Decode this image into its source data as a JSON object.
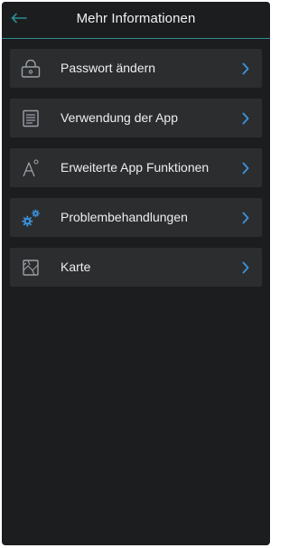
{
  "header": {
    "title": "Mehr Informationen",
    "back_icon": "arrow-left-icon"
  },
  "menu": {
    "items": [
      {
        "label": "Passwort ändern",
        "icon": "lock-icon"
      },
      {
        "label": "Verwendung der App",
        "icon": "document-icon"
      },
      {
        "label": "Erweiterte App Funktionen",
        "icon": "sparkle-a-icon"
      },
      {
        "label": "Problembehandlungen",
        "icon": "gears-icon"
      },
      {
        "label": "Karte",
        "icon": "map-icon"
      }
    ],
    "chevron_icon": "chevron-right-icon"
  },
  "colors": {
    "background": "#1c1d1f",
    "item_background": "#2c2d2f",
    "accent": "#2d8c93",
    "icon_blue": "#3a8fd6",
    "text": "#eeeeee"
  }
}
